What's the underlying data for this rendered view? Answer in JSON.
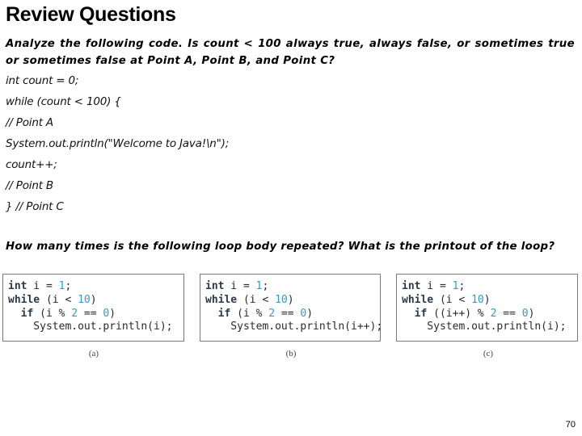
{
  "slide": {
    "title": "Review Questions",
    "question1": "Analyze the following code. Is count < 100 always true, always false, or  sometimes true or sometimes false at Point A, Point B, and Point C?",
    "code_lines": [
      "int count = 0;",
      "while (count < 100) {",
      "// Point A",
      "System.out.println(\"Welcome to Java!\\n\");",
      "count++;",
      "// Point B",
      "} // Point C"
    ],
    "question2": "How many times is the following loop body repeated? What is the printout of the loop?",
    "figures": [
      {
        "caption": "(a)",
        "lines": [
          [
            {
              "t": "int",
              "c": "kw"
            },
            {
              "t": " i = ",
              "c": ""
            },
            {
              "t": "1",
              "c": "num"
            },
            {
              "t": ";",
              "c": ""
            }
          ],
          [
            {
              "t": "while",
              "c": "kw"
            },
            {
              "t": " (i < ",
              "c": ""
            },
            {
              "t": "10",
              "c": "num"
            },
            {
              "t": ")",
              "c": ""
            }
          ],
          [
            {
              "t": "  ",
              "c": ""
            },
            {
              "t": "if",
              "c": "kw"
            },
            {
              "t": " (i % ",
              "c": ""
            },
            {
              "t": "2",
              "c": "num"
            },
            {
              "t": " == ",
              "c": ""
            },
            {
              "t": "0",
              "c": "num"
            },
            {
              "t": ")",
              "c": ""
            }
          ],
          [
            {
              "t": "    System.out.println(i);",
              "c": ""
            }
          ]
        ]
      },
      {
        "caption": "(b)",
        "lines": [
          [
            {
              "t": "int",
              "c": "kw"
            },
            {
              "t": " i = ",
              "c": ""
            },
            {
              "t": "1",
              "c": "num"
            },
            {
              "t": ";",
              "c": ""
            }
          ],
          [
            {
              "t": "while",
              "c": "kw"
            },
            {
              "t": " (i < ",
              "c": ""
            },
            {
              "t": "10",
              "c": "num"
            },
            {
              "t": ")",
              "c": ""
            }
          ],
          [
            {
              "t": "  ",
              "c": ""
            },
            {
              "t": "if",
              "c": "kw"
            },
            {
              "t": " (i % ",
              "c": ""
            },
            {
              "t": "2",
              "c": "num"
            },
            {
              "t": " == ",
              "c": ""
            },
            {
              "t": "0",
              "c": "num"
            },
            {
              "t": ")",
              "c": ""
            }
          ],
          [
            {
              "t": "    System.out.println(i++);",
              "c": ""
            }
          ]
        ]
      },
      {
        "caption": "(c)",
        "lines": [
          [
            {
              "t": "int",
              "c": "kw"
            },
            {
              "t": " i = ",
              "c": ""
            },
            {
              "t": "1",
              "c": "num"
            },
            {
              "t": ";",
              "c": ""
            }
          ],
          [
            {
              "t": "while",
              "c": "kw"
            },
            {
              "t": " (i < ",
              "c": ""
            },
            {
              "t": "10",
              "c": "num"
            },
            {
              "t": ")",
              "c": ""
            }
          ],
          [
            {
              "t": "  ",
              "c": ""
            },
            {
              "t": "if",
              "c": "kw"
            },
            {
              "t": " ((i++) % ",
              "c": ""
            },
            {
              "t": "2",
              "c": "num"
            },
            {
              "t": " == ",
              "c": ""
            },
            {
              "t": "0",
              "c": "num"
            },
            {
              "t": ")",
              "c": ""
            }
          ],
          [
            {
              "t": "    System.out.println(i);",
              "c": ""
            }
          ]
        ]
      }
    ],
    "page_number": "70"
  },
  "colors": {
    "keyword": "#2b3a4a",
    "number": "#2f9bd6",
    "box_border": "#7a7a7a"
  }
}
